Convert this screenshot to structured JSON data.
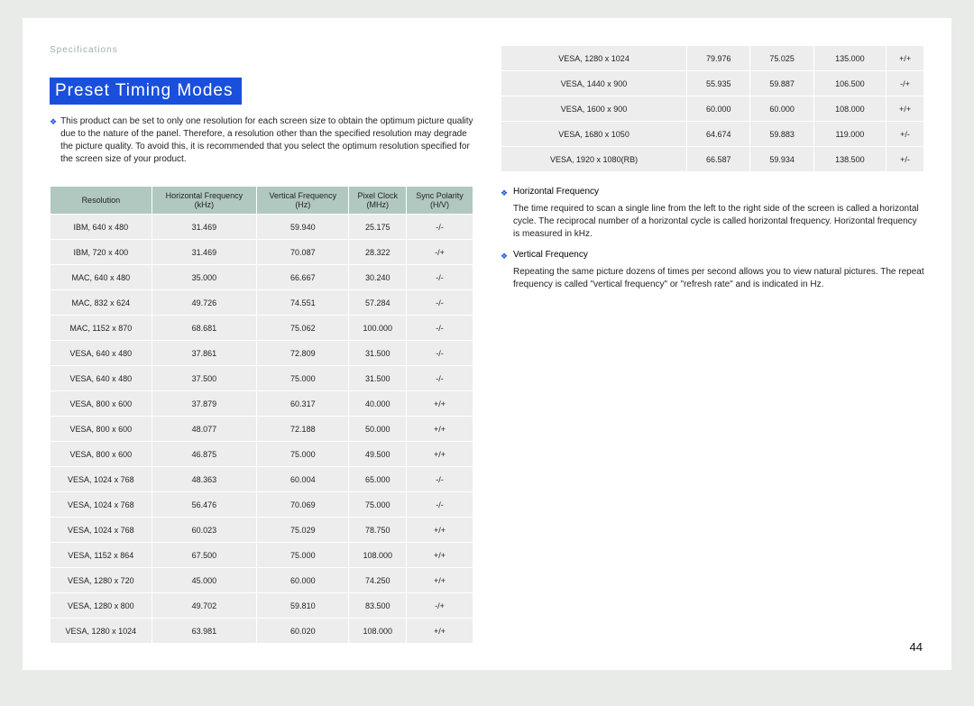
{
  "breadcrumb": "Specifications",
  "title": "Preset Timing Modes",
  "intro": "This product can be set to only one resolution for each screen size to obtain the optimum picture quality due to the nature of the panel. Therefore, a resolution other than the specified resolution may degrade the picture quality. To avoid this, it is recommended that you select the optimum resolution specified for the screen size of your product.",
  "headers": {
    "res": "Resolution",
    "hf_line1": "Horizontal Frequency",
    "hf_line2": "(kHz)",
    "vf_line1": "Vertical Frequency",
    "vf_line2": "(Hz)",
    "pc_line1": "Pixel Clock",
    "pc_line2": "(MHz)",
    "sp_line1": "Sync Polarity",
    "sp_line2": "(H/V)"
  },
  "rows1": [
    {
      "r": "IBM, 640 x 480",
      "hf": "31.469",
      "vf": "59.940",
      "pc": "25.175",
      "sp": "-/-"
    },
    {
      "r": "IBM, 720 x 400",
      "hf": "31.469",
      "vf": "70.087",
      "pc": "28.322",
      "sp": "-/+"
    },
    {
      "r": "MAC, 640 x 480",
      "hf": "35.000",
      "vf": "66.667",
      "pc": "30.240",
      "sp": "-/-"
    },
    {
      "r": "MAC, 832 x 624",
      "hf": "49.726",
      "vf": "74.551",
      "pc": "57.284",
      "sp": "-/-"
    },
    {
      "r": "MAC, 1152 x 870",
      "hf": "68.681",
      "vf": "75.062",
      "pc": "100.000",
      "sp": "-/-"
    },
    {
      "r": "VESA, 640 x 480",
      "hf": "37.861",
      "vf": "72.809",
      "pc": "31.500",
      "sp": "-/-"
    },
    {
      "r": "VESA, 640 x 480",
      "hf": "37.500",
      "vf": "75.000",
      "pc": "31.500",
      "sp": "-/-"
    },
    {
      "r": "VESA, 800 x 600",
      "hf": "37.879",
      "vf": "60.317",
      "pc": "40.000",
      "sp": "+/+"
    },
    {
      "r": "VESA, 800 x 600",
      "hf": "48.077",
      "vf": "72.188",
      "pc": "50.000",
      "sp": "+/+"
    },
    {
      "r": "VESA, 800 x 600",
      "hf": "46.875",
      "vf": "75.000",
      "pc": "49.500",
      "sp": "+/+"
    },
    {
      "r": "VESA, 1024 x 768",
      "hf": "48.363",
      "vf": "60.004",
      "pc": "65.000",
      "sp": "-/-"
    },
    {
      "r": "VESA, 1024 x 768",
      "hf": "56.476",
      "vf": "70.069",
      "pc": "75.000",
      "sp": "-/-"
    },
    {
      "r": "VESA, 1024 x 768",
      "hf": "60.023",
      "vf": "75.029",
      "pc": "78.750",
      "sp": "+/+"
    },
    {
      "r": "VESA, 1152 x 864",
      "hf": "67.500",
      "vf": "75.000",
      "pc": "108.000",
      "sp": "+/+"
    },
    {
      "r": "VESA, 1280 x 720",
      "hf": "45.000",
      "vf": "60.000",
      "pc": "74.250",
      "sp": "+/+"
    },
    {
      "r": "VESA, 1280 x 800",
      "hf": "49.702",
      "vf": "59.810",
      "pc": "83.500",
      "sp": "-/+"
    },
    {
      "r": "VESA, 1280 x 1024",
      "hf": "63.981",
      "vf": "60.020",
      "pc": "108.000",
      "sp": "+/+"
    }
  ],
  "rows2": [
    {
      "r": "VESA, 1280 x 1024",
      "hf": "79.976",
      "vf": "75.025",
      "pc": "135.000",
      "sp": "+/+"
    },
    {
      "r": "VESA, 1440 x 900",
      "hf": "55.935",
      "vf": "59.887",
      "pc": "106.500",
      "sp": "-/+"
    },
    {
      "r": "VESA, 1600 x 900",
      "hf": "60.000",
      "vf": "60.000",
      "pc": "108.000",
      "sp": "+/+"
    },
    {
      "r": "VESA, 1680 x 1050",
      "hf": "64.674",
      "vf": "59.883",
      "pc": "119.000",
      "sp": "+/-"
    },
    {
      "r": "VESA, 1920 x 1080(RB)",
      "hf": "66.587",
      "vf": "59.934",
      "pc": "138.500",
      "sp": "+/-"
    }
  ],
  "defs": [
    {
      "title": "Horizontal Frequency",
      "body": "The time required to scan a single line from the left to the right side of the screen is called a horizontal cycle. The reciprocal number of a horizontal cycle is called horizontal frequency. Horizontal frequency is measured in kHz."
    },
    {
      "title": "Vertical Frequency",
      "body": "Repeating the same picture dozens of times per second allows you to view natural pictures. The repeat frequency is called \"vertical frequency\" or \"refresh rate\" and is indicated in Hz."
    }
  ],
  "pagenum": "44"
}
